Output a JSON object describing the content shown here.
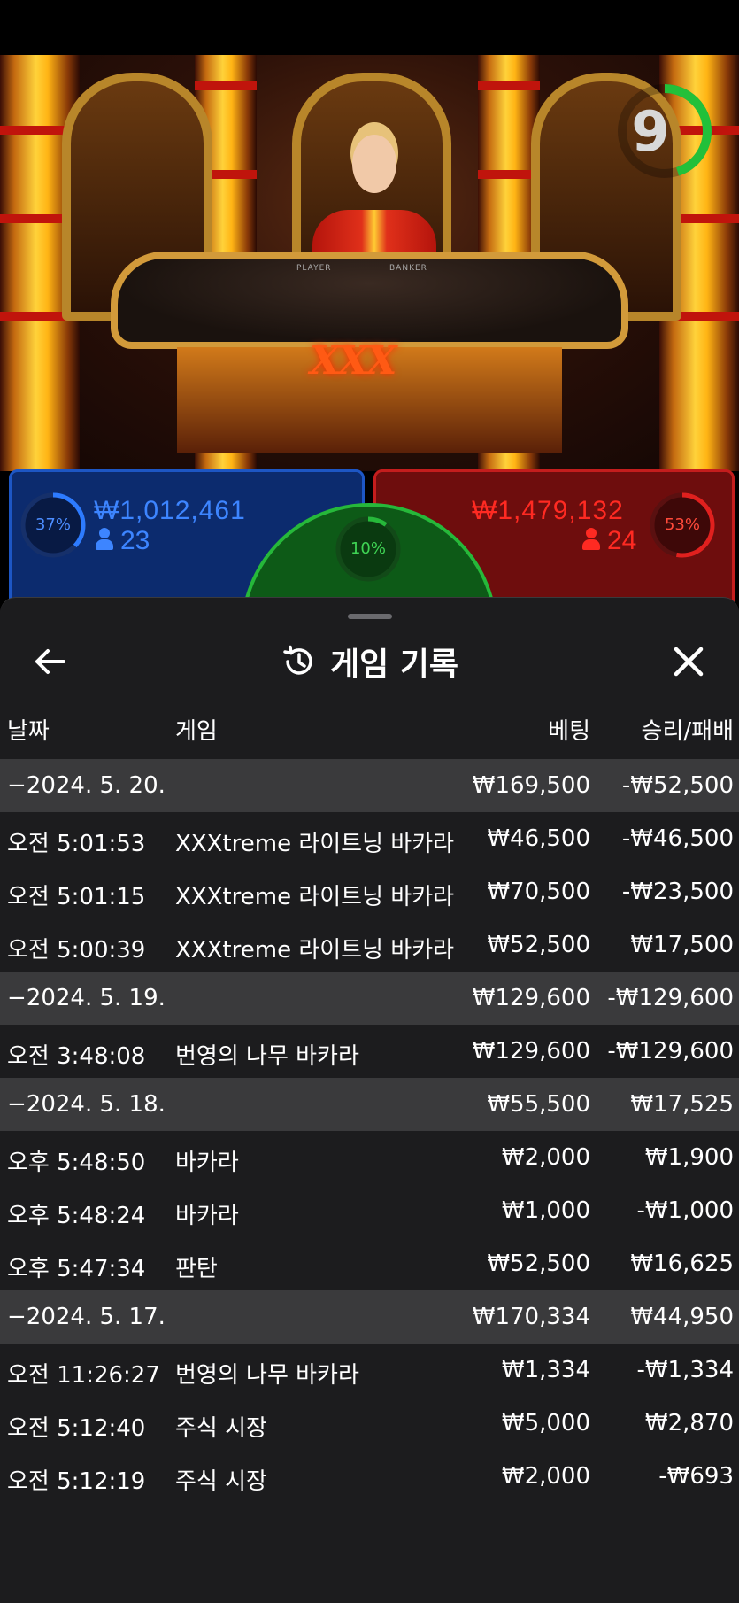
{
  "timer": {
    "value": "9",
    "fraction_remaining": 0.45,
    "color": "#22c03a"
  },
  "table": {
    "logo": "XXX",
    "player_label": "PLAYER",
    "banker_label": "BANKER"
  },
  "bets": {
    "player": {
      "percent": "37%",
      "percent_value": 0.37,
      "amount": "₩1,012,461",
      "count": "23",
      "color": "#2d7bff"
    },
    "banker": {
      "percent": "53%",
      "percent_value": 0.53,
      "amount": "₩1,479,132",
      "count": "24",
      "color": "#e0201e"
    },
    "tie": {
      "percent": "10%",
      "percent_value": 0.1,
      "color": "#26b83a"
    }
  },
  "history": {
    "title": "게임 기록",
    "icons": {
      "back": "back-arrow-icon",
      "title": "history-clock-icon",
      "close": "close-icon"
    },
    "headers": {
      "date": "날짜",
      "game": "게임",
      "bet": "베팅",
      "result": "승리/패배"
    },
    "rows": [
      {
        "type": "date",
        "time": "−2024. 5. 20.",
        "game": "",
        "bet": "₩169,500",
        "result": "-₩52,500"
      },
      {
        "type": "entry",
        "time": "오전 5:01:53",
        "game": "XXXtreme 라이트닝 바카라",
        "bet": "₩46,500",
        "result": "-₩46,500"
      },
      {
        "type": "entry",
        "time": "오전 5:01:15",
        "game": "XXXtreme 라이트닝 바카라",
        "bet": "₩70,500",
        "result": "-₩23,500"
      },
      {
        "type": "entry",
        "time": "오전 5:00:39",
        "game": "XXXtreme 라이트닝 바카라",
        "bet": "₩52,500",
        "result": "₩17,500"
      },
      {
        "type": "date",
        "time": "−2024. 5. 19.",
        "game": "",
        "bet": "₩129,600",
        "result": "-₩129,600"
      },
      {
        "type": "entry",
        "time": "오전 3:48:08",
        "game": "번영의 나무 바카라",
        "bet": "₩129,600",
        "result": "-₩129,600"
      },
      {
        "type": "date",
        "time": "−2024. 5. 18.",
        "game": "",
        "bet": "₩55,500",
        "result": "₩17,525"
      },
      {
        "type": "entry",
        "time": "오후 5:48:50",
        "game": "바카라",
        "bet": "₩2,000",
        "result": "₩1,900"
      },
      {
        "type": "entry",
        "time": "오후 5:48:24",
        "game": "바카라",
        "bet": "₩1,000",
        "result": "-₩1,000"
      },
      {
        "type": "entry",
        "time": "오후 5:47:34",
        "game": "판탄",
        "bet": "₩52,500",
        "result": "₩16,625"
      },
      {
        "type": "date",
        "time": "−2024. 5. 17.",
        "game": "",
        "bet": "₩170,334",
        "result": "₩44,950"
      },
      {
        "type": "entry",
        "time": "오전 11:26:27",
        "game": "번영의 나무 바카라",
        "bet": "₩1,334",
        "result": "-₩1,334"
      },
      {
        "type": "entry",
        "time": "오전 5:12:40",
        "game": "주식 시장",
        "bet": "₩5,000",
        "result": "₩2,870"
      },
      {
        "type": "entry",
        "time": "오전 5:12:19",
        "game": "주식 시장",
        "bet": "₩2,000",
        "result": "-₩693"
      }
    ]
  }
}
